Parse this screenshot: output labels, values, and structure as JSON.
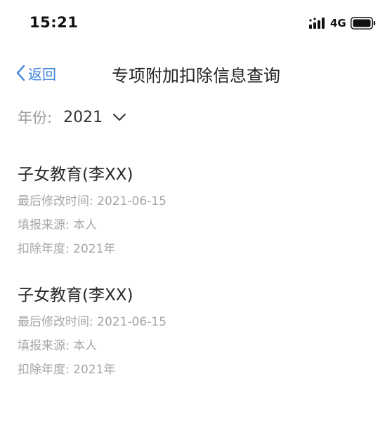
{
  "status_bar": {
    "time": "15:21",
    "network": "4G",
    "icons": [
      "signal-icon",
      "battery-icon"
    ]
  },
  "nav": {
    "back_label": "返回",
    "title": "专项附加扣除信息查询",
    "accent_color": "#3b82e0"
  },
  "filter": {
    "year_label": "年份:",
    "year_value": "2021"
  },
  "records": [
    {
      "title": "子女教育(李XX)",
      "modified": "最后修改时间: 2021-06-15",
      "source": "填报来源: 本人",
      "year": "扣除年度: 2021年"
    },
    {
      "title": "子女教育(李XX)",
      "modified": "最后修改时间: 2021-06-15",
      "source": "填报来源: 本人",
      "year": "扣除年度: 2021年"
    }
  ]
}
